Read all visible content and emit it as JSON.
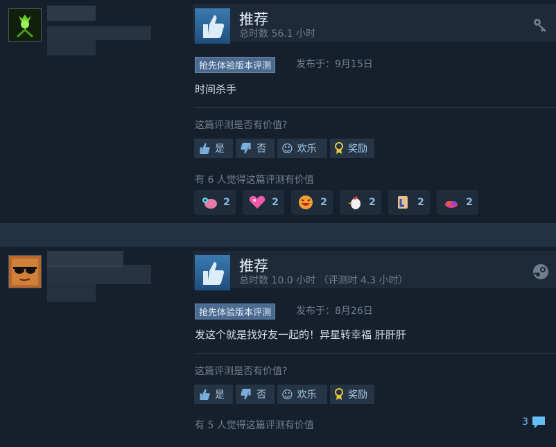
{
  "reviews": [
    {
      "verdict": "推荐",
      "hours": "总时数 56.1 小时",
      "early_access_tag": "抢先体验版本评测",
      "posted": "发布于：9月15日",
      "content": "时间杀手",
      "helpful_question": "这篇评测是否有价值?",
      "buttons": {
        "yes": "是",
        "no": "否",
        "funny": "欢乐",
        "award": "奖励"
      },
      "helpful_count": "有 6 人觉得这篇评测有价值",
      "awards": [
        {
          "icon": "bug-creature-award-icon",
          "count": "2"
        },
        {
          "icon": "pink-heart-award-icon",
          "count": "2"
        },
        {
          "icon": "laughing-face-award-icon",
          "count": "2"
        },
        {
          "icon": "chicken-award-icon",
          "count": "2"
        },
        {
          "icon": "scroll-award-icon",
          "count": "2"
        },
        {
          "icon": "flame-creature-award-icon",
          "count": "2"
        }
      ],
      "corner_icon": "key-icon"
    },
    {
      "verdict": "推荐",
      "hours": "总时数 10.0 小时 （评测时 4.3 小时）",
      "early_access_tag": "抢先体验版本评测",
      "posted": "发布于：8月26日",
      "content": "发这个就是找好友一起的！异星转幸福 肝肝肝",
      "helpful_question": "这篇评测是否有价值?",
      "buttons": {
        "yes": "是",
        "no": "否",
        "funny": "欢乐",
        "award": "奖励"
      },
      "helpful_count": "有 5 人觉得这篇评测有价值",
      "comment_count": "3",
      "corner_icon": "steam-icon"
    }
  ],
  "colors": {
    "accent": "#66c0f4",
    "background": "#1b2838",
    "card": "#16202d"
  }
}
